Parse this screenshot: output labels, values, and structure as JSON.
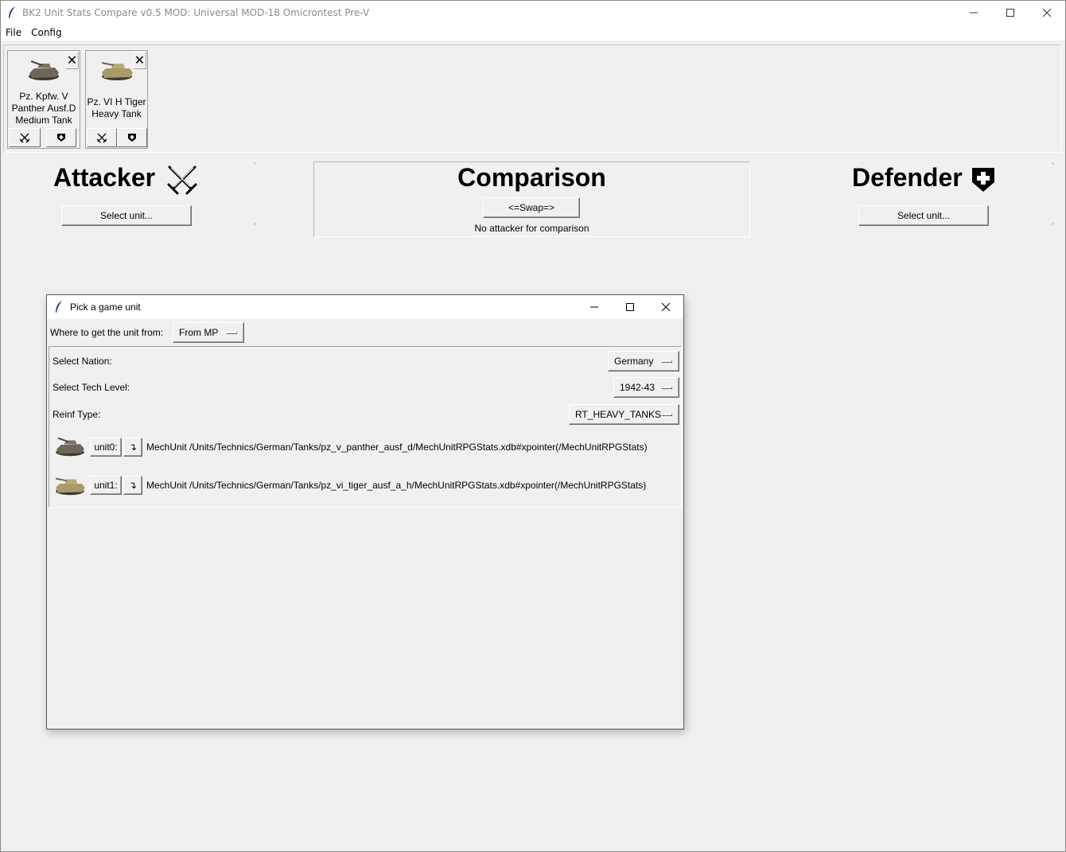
{
  "window": {
    "title": "BK2 Unit Stats Compare v0.5 MOD: Universal MOD-18 Omicrontest Pre-V",
    "minimize_glyph": "—",
    "maximize_glyph": "☐",
    "close_glyph": "✕"
  },
  "menubar": {
    "items": [
      {
        "label": "File"
      },
      {
        "label": "Config"
      }
    ]
  },
  "tray": {
    "cards": [
      {
        "label_line1": "Pz. Kpfw. V",
        "label_line2": "Panther Ausf.D",
        "label_line3": "Medium Tank",
        "close": "✕",
        "icon": "panther-tank-icon",
        "tank_color": "#6f6659"
      },
      {
        "label_line1": "Pz. VI H Tiger",
        "label_line2": "Heavy Tank",
        "close": "✕",
        "icon": "tiger-tank-icon",
        "tank_color": "#a89a6a"
      }
    ]
  },
  "attacker": {
    "title": "Attacker",
    "select_label": "Select unit...",
    "icon": "crossed-swords-icon"
  },
  "comparison": {
    "title": "Comparison",
    "swap_label": "<=Swap=>",
    "status": "No attacker for comparison"
  },
  "defender": {
    "title": "Defender",
    "select_label": "Select unit...",
    "icon": "shield-plus-icon"
  },
  "scroll": {
    "up": "˄",
    "down": "˅"
  },
  "dialog": {
    "title": "Pick a game unit",
    "source_label": "Where to get the unit from:",
    "source_value": "From MP",
    "nation_label": "Select Nation:",
    "nation_value": "Germany",
    "tech_label": "Select Tech Level:",
    "tech_value": "1942-43",
    "reinf_label": "Reinf Type:",
    "reinf_value": "RT_HEAVY_TANKS",
    "units": [
      {
        "button": "unit0:",
        "arrow": "↴",
        "path": "MechUnit /Units/Technics/German/Tanks/pz_v_panther_ausf_d/MechUnitRPGStats.xdb#xpointer(/MechUnitRPGStats)",
        "tank_color": "#6f6659"
      },
      {
        "button": "unit1:",
        "arrow": "↴",
        "path": "MechUnit /Units/Technics/German/Tanks/pz_vi_tiger_ausf_a_h/MechUnitRPGStats.xdb#xpointer(/MechUnitRPGStats)",
        "tank_color": "#a89a6a"
      }
    ]
  }
}
